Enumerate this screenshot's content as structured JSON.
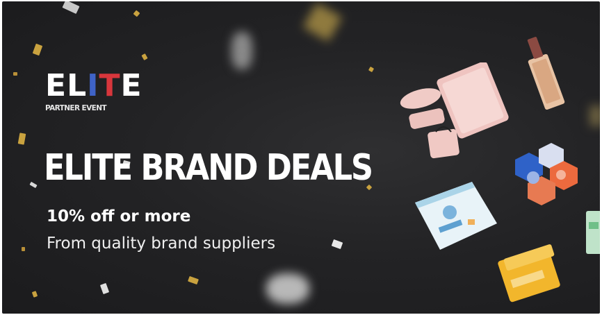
{
  "banner": {
    "logo": {
      "letters": [
        {
          "char": "E",
          "color": "#ffffff"
        },
        {
          "char": "L",
          "color": "#ffffff"
        },
        {
          "char": "I",
          "color": "#3f63c7"
        },
        {
          "char": "T",
          "color": "#d8363c"
        },
        {
          "char": "E",
          "color": "#ffffff"
        }
      ],
      "subtitle": "PARTNER EVENT"
    },
    "headline": "ELITE BRAND DEALS",
    "subheadline": "10% off or more",
    "tagline": "From quality brand suppliers",
    "colors": {
      "background": "#232325",
      "text": "#ffffff",
      "logo_blue": "#3f63c7",
      "logo_red": "#d8363c",
      "confetti_gold": "#c9a23f"
    },
    "products": [
      {
        "name": "pink-pouch-set-icon"
      },
      {
        "name": "perfume-bottle-icon"
      },
      {
        "name": "hexagon-boxes-icon"
      },
      {
        "name": "baby-product-box-icon"
      },
      {
        "name": "yellow-cosmetic-jar-icon"
      },
      {
        "name": "green-box-icon"
      }
    ]
  }
}
